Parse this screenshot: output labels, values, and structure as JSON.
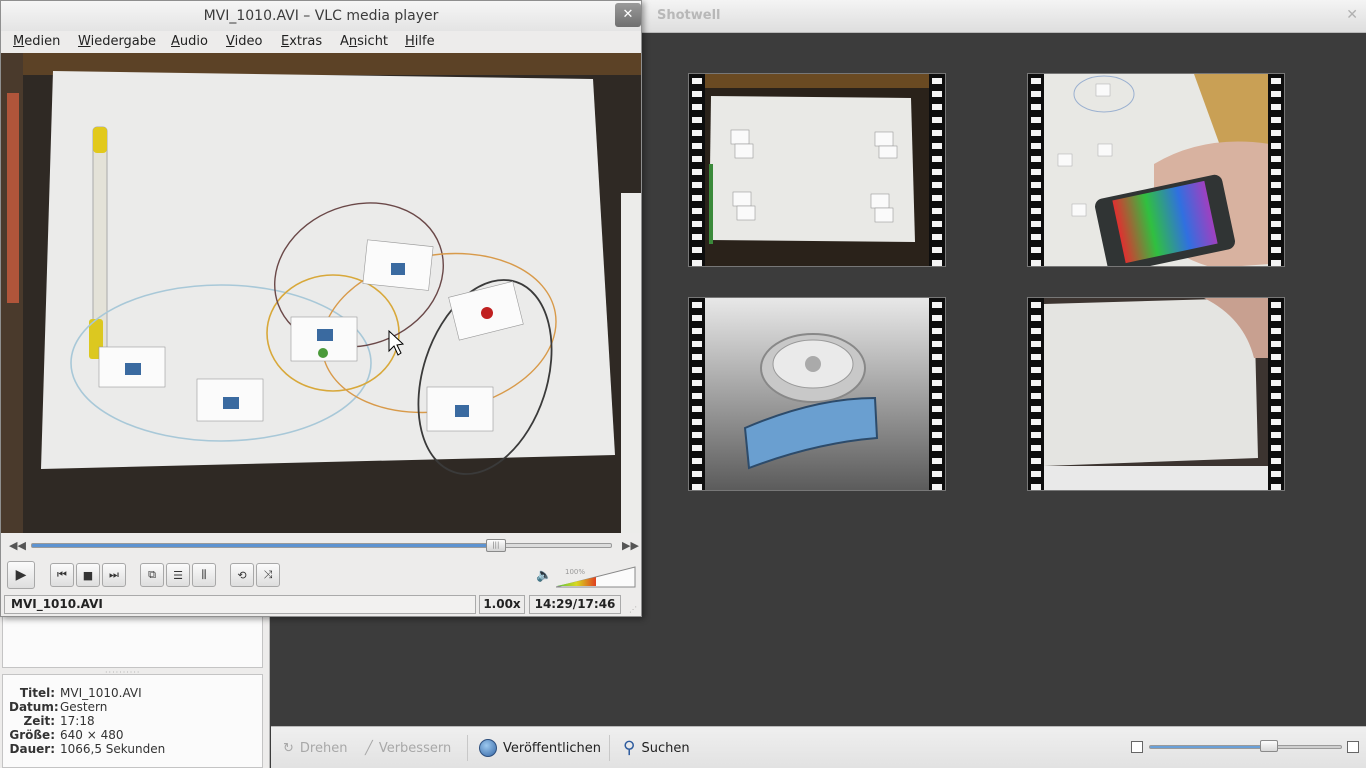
{
  "shotwell": {
    "title": "Shotwell",
    "close_glyph": "✕",
    "info": [
      {
        "key": "Titel:",
        "value": "MVI_1010.AVI"
      },
      {
        "key": "Datum:",
        "value": "Gestern"
      },
      {
        "key": "Zeit:",
        "value": "17:18"
      },
      {
        "key": "Größe:",
        "value": "640 × 480"
      },
      {
        "key": "Dauer:",
        "value": "1066,5 Sekunden"
      }
    ],
    "toolbar": {
      "rotate": "Drehen",
      "enhance": "Verbessern",
      "publish": "Veröffentlichen",
      "search": "Suchen"
    },
    "zoom_level": 0.62
  },
  "vlc": {
    "title": "MVI_1010.AVI – VLC media player",
    "close_glyph": "✕",
    "menu": [
      {
        "label": "Medien",
        "accel": "M"
      },
      {
        "label": "Wiedergabe",
        "accel": "W"
      },
      {
        "label": "Audio",
        "accel": "A"
      },
      {
        "label": "Video",
        "accel": "V"
      },
      {
        "label": "Extras",
        "accel": "E"
      },
      {
        "label": "Ansicht",
        "accel": "n"
      },
      {
        "label": "Hilfe",
        "accel": "H"
      }
    ],
    "seek_position": 0.8,
    "volume_label": "100%",
    "status": {
      "file": "MVI_1010.AVI",
      "speed": "1.00x",
      "time": "14:29/17:46"
    }
  },
  "colors": {
    "accent": "#5d93d1",
    "background": "#3c3c3c"
  }
}
